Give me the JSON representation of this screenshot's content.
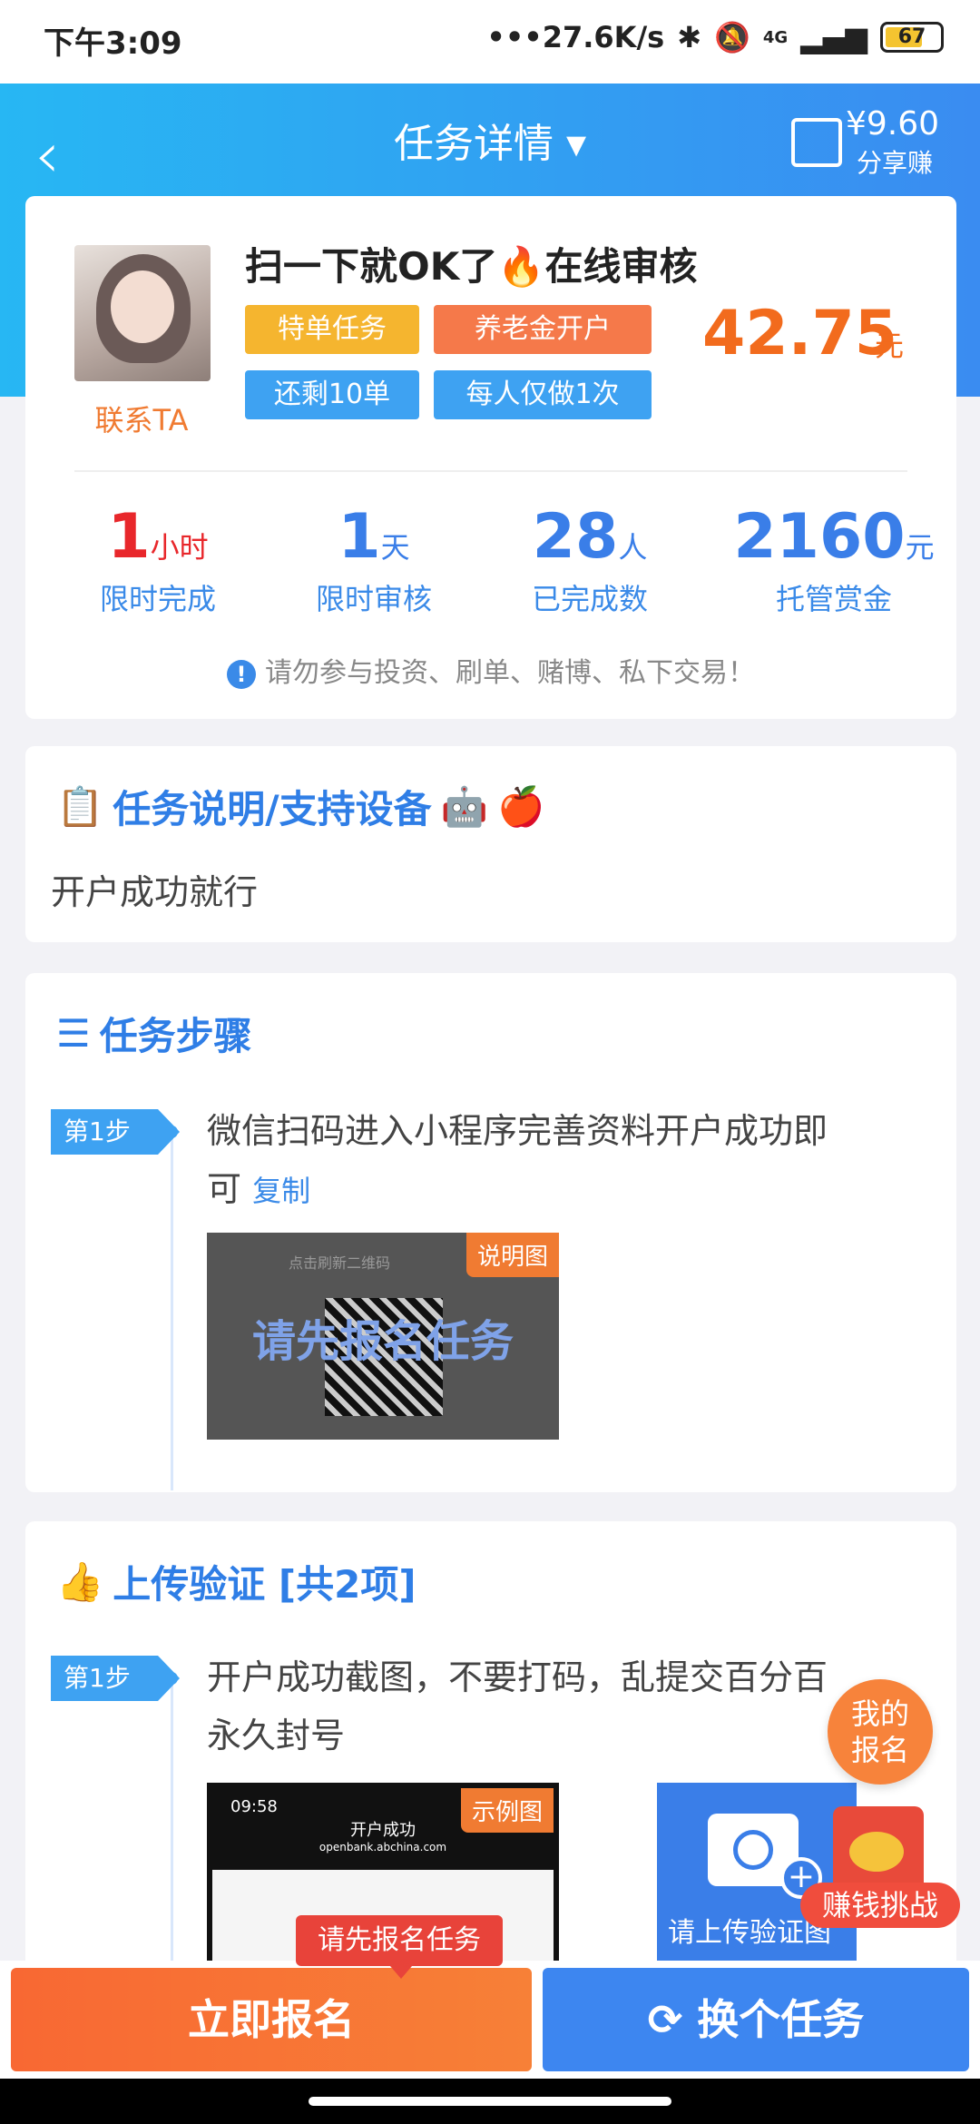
{
  "status": {
    "time": "下午3:09",
    "speed": "•••27.6K/s",
    "network": "4G",
    "battery": "67"
  },
  "header": {
    "back_icon": "chevron-left-icon",
    "title": "任务详情 ▾",
    "share_amount": "¥9.60",
    "share_label": "分享赚"
  },
  "task": {
    "contact": "联系TA",
    "title": "扫一下就OK了🔥在线审核",
    "tags": [
      "特单任务",
      "养老金开户",
      "还剩10单",
      "每人仅做1次"
    ],
    "price": "42.75",
    "price_unit": "元"
  },
  "stats": [
    {
      "num": "1",
      "unit": "小时",
      "label": "限时完成",
      "color": "#e8272b"
    },
    {
      "num": "1",
      "unit": "天",
      "label": "限时审核",
      "color": "#3a7ee8"
    },
    {
      "num": "28",
      "unit": "人",
      "label": "已完成数",
      "color": "#3a7ee8"
    },
    {
      "num": "2160",
      "unit": "元",
      "label": "托管赏金",
      "color": "#3a7ee8"
    }
  ],
  "warning": "请勿参与投资、刷单、赌博、私下交易！",
  "desc": {
    "title": "任务说明/支持设备",
    "body": "开户成功就行"
  },
  "steps": {
    "title": "任务步骤",
    "badge": "第1步",
    "line1": "微信扫码进入小程序完善资料开户成功即",
    "line2": "可",
    "copy": "复制",
    "img_top": "点击刷新二维码",
    "overlay": "请先报名任务",
    "corner": "说明图"
  },
  "upload": {
    "title": "上传验证 [共2项]",
    "badge": "第1步",
    "line1": "开户成功截图，不要打码，乱提交百分百",
    "line2": "永久封号",
    "shot_time": "09:58",
    "shot_title": "开户成功",
    "shot_url": "openbank.abchina.com",
    "corner": "示例图",
    "upload_label": "请上传验证图"
  },
  "float": {
    "myreg": "我的报名",
    "challenge": "赚钱挑战"
  },
  "bottom": {
    "tooltip": "请先报名任务",
    "signup": "立即报名",
    "switch": "换个任务"
  }
}
